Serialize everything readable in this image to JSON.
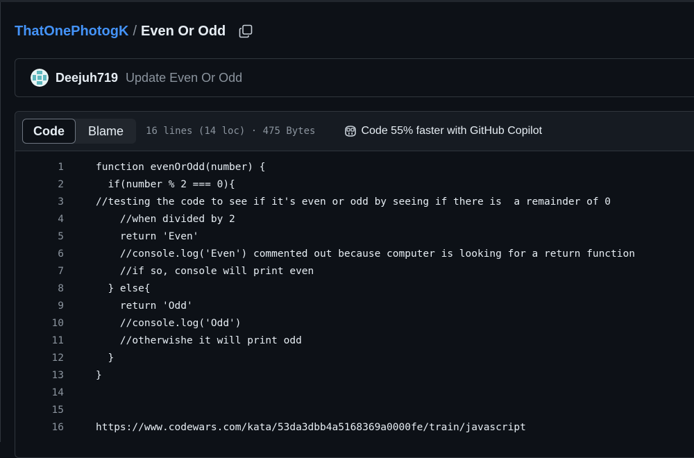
{
  "breadcrumb": {
    "owner": "ThatOnePhotogK",
    "separator": "/",
    "file": "Even Or Odd"
  },
  "commit": {
    "author": "Deejuh719",
    "message": "Update Even Or Odd"
  },
  "file_header": {
    "tabs": [
      {
        "label": "Code",
        "active": true
      },
      {
        "label": "Blame",
        "active": false
      }
    ],
    "stats": "16 lines (14 loc) · 475 Bytes",
    "copilot": "Code 55% faster with GitHub Copilot"
  },
  "code": {
    "lines": [
      {
        "n": "1",
        "text": "function evenOrOdd(number) {"
      },
      {
        "n": "2",
        "text": "  if(number % 2 === 0){"
      },
      {
        "n": "3",
        "text": "//testing the code to see if it's even or odd by seeing if there is  a remainder of 0"
      },
      {
        "n": "4",
        "text": "    //when divided by 2"
      },
      {
        "n": "5",
        "text": "    return 'Even'"
      },
      {
        "n": "6",
        "text": "    //console.log('Even') commented out because computer is looking for a return function"
      },
      {
        "n": "7",
        "text": "    //if so, console will print even"
      },
      {
        "n": "8",
        "text": "  } else{"
      },
      {
        "n": "9",
        "text": "    return 'Odd'"
      },
      {
        "n": "10",
        "text": "    //console.log('Odd')"
      },
      {
        "n": "11",
        "text": "    //otherwishe it will print odd"
      },
      {
        "n": "12",
        "text": "  }"
      },
      {
        "n": "13",
        "text": "}"
      },
      {
        "n": "14",
        "text": ""
      },
      {
        "n": "15",
        "text": ""
      },
      {
        "n": "16",
        "text": "https://www.codewars.com/kata/53da3dbb4a5168369a0000fe/train/javascript"
      }
    ]
  },
  "colors": {
    "background": "#0d1117",
    "accent_link": "#4493f8",
    "muted": "#8b949e",
    "border": "#30363d"
  }
}
